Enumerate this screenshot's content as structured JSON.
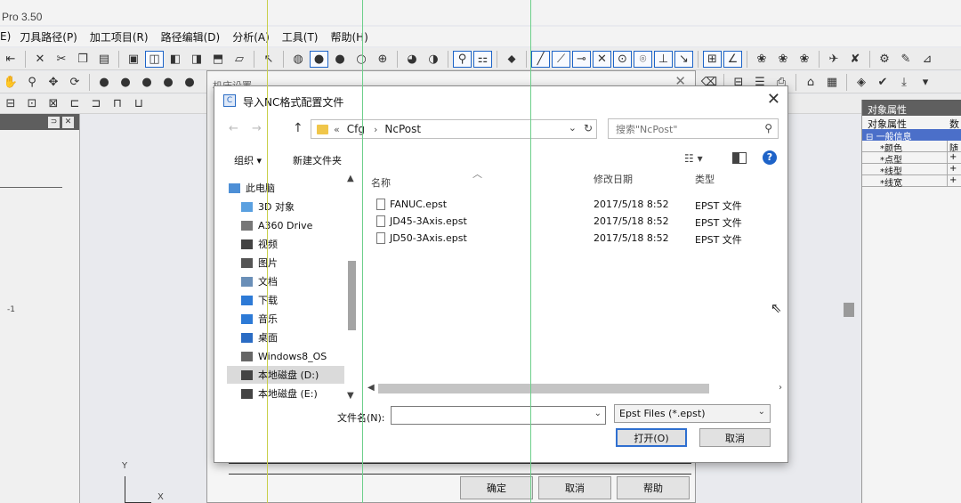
{
  "app": {
    "title": "Pro 3.50",
    "menus": [
      "E)",
      "刀具路径(P)",
      "加工项目(R)",
      "路径编辑(D)",
      "分析(A)",
      "工具(T)",
      "帮助(H)"
    ]
  },
  "left_panel": {
    "coord_text": "-1"
  },
  "machine_dialog": {
    "title": "机床设置",
    "ok_label": "确定",
    "cancel_label": "取消",
    "help_label": "帮助"
  },
  "property_panel": {
    "title": "对象属性",
    "subheader": "对象属性",
    "subheader_right": "数",
    "group": "一般信息",
    "rows": [
      {
        "key": "*颜色",
        "value": "随"
      },
      {
        "key": "*点型",
        "value": "+"
      },
      {
        "key": "*线型",
        "value": "+"
      },
      {
        "key": "*线宽",
        "value": "+"
      }
    ]
  },
  "axis": {
    "x": "X",
    "y": "Y"
  },
  "dialog": {
    "title": "导入NC格式配置文件",
    "breadcrumb": [
      "«",
      "Cfg",
      "›",
      "NcPost"
    ],
    "search_placeholder": "搜索\"NcPost\"",
    "organize_label": "组织 ▾",
    "new_folder_label": "新建文件夹",
    "nav_items": [
      {
        "label": "此电脑",
        "icon": "pc-icon",
        "color": "#4d8fd6"
      },
      {
        "label": "3D 对象",
        "icon": "3d-objects-icon",
        "color": "#5aa0e0"
      },
      {
        "label": "A360 Drive",
        "icon": "cloud-drive-icon",
        "color": "#777777"
      },
      {
        "label": "视频",
        "icon": "video-icon",
        "color": "#444444"
      },
      {
        "label": "图片",
        "icon": "picture-icon",
        "color": "#555555"
      },
      {
        "label": "文档",
        "icon": "document-icon",
        "color": "#6a8fb8"
      },
      {
        "label": "下载",
        "icon": "download-icon",
        "color": "#2d7ad6"
      },
      {
        "label": "音乐",
        "icon": "music-icon",
        "color": "#2d7ad6"
      },
      {
        "label": "桌面",
        "icon": "desktop-icon",
        "color": "#2b6cc4"
      },
      {
        "label": "Windows8_OS",
        "icon": "drive-icon",
        "color": "#666666"
      },
      {
        "label": "本地磁盘 (D:)",
        "icon": "drive-icon",
        "color": "#444444"
      },
      {
        "label": "本地磁盘 (E:)",
        "icon": "drive-icon",
        "color": "#444444"
      }
    ],
    "columns": {
      "name": "名称",
      "modified": "修改日期",
      "type": "类型"
    },
    "files": [
      {
        "name": "FANUC.epst",
        "modified": "2017/5/18 8:52",
        "type": "EPST 文件"
      },
      {
        "name": "JD45-3Axis.epst",
        "modified": "2017/5/18 8:52",
        "type": "EPST 文件"
      },
      {
        "name": "JD50-3Axis.epst",
        "modified": "2017/5/18 8:52",
        "type": "EPST 文件"
      }
    ],
    "filename_label": "文件名(N):",
    "filename_value": "",
    "filter_value": "Epst Files (*.epst)",
    "open_label": "打开(O)",
    "cancel_label": "取消"
  },
  "colors": {
    "accent": "#2f6fd0",
    "panel_header": "#5f5f5f",
    "group": "#4b6fc9"
  }
}
